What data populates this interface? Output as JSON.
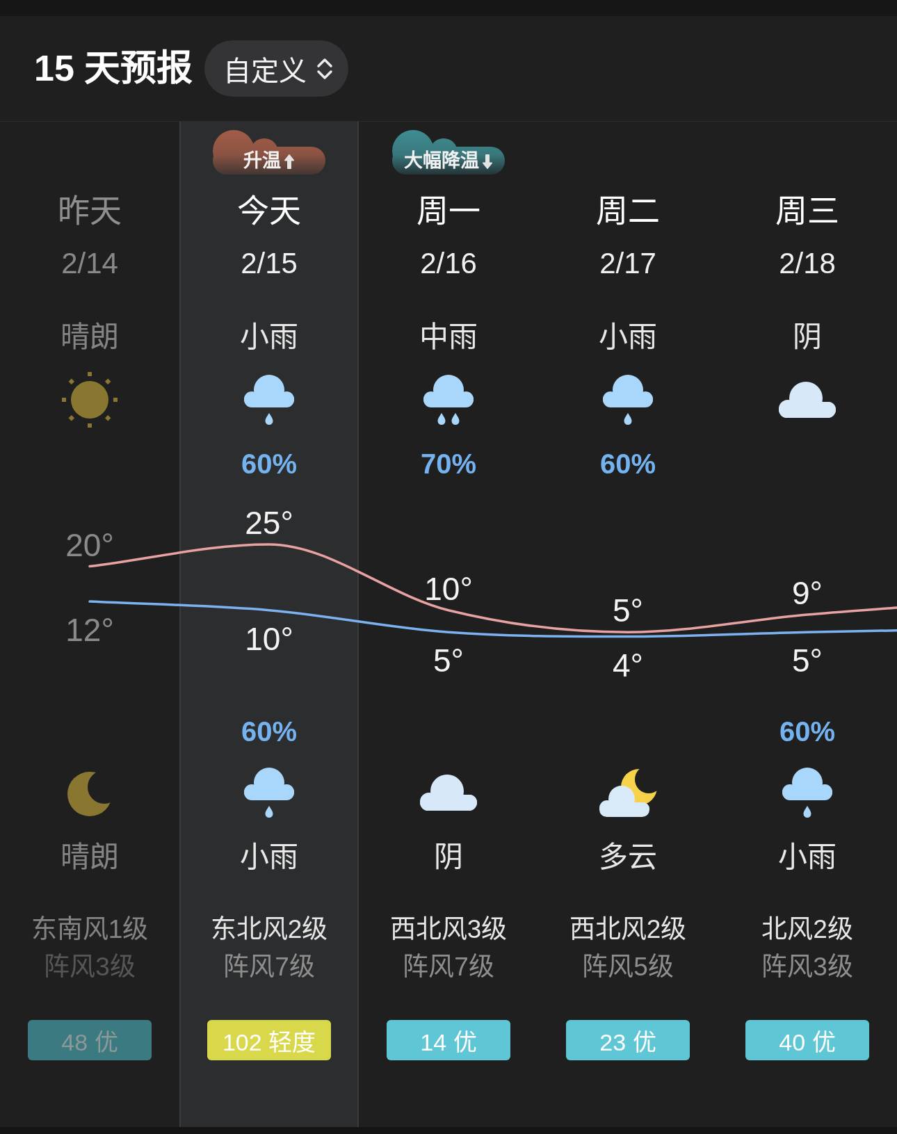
{
  "header": {
    "title": "15 天预报",
    "picker": {
      "label": "自定义"
    }
  },
  "days": [
    {
      "day": "昨天",
      "date": "2/14",
      "past": true,
      "selected": false,
      "day_weather": {
        "kind": "sunny",
        "condition": "晴朗"
      },
      "high": "20°",
      "low": "12°",
      "night_weather": {
        "kind": "moon",
        "condition": "晴朗"
      },
      "wind": "东南风1级",
      "gust": "阵风3级",
      "aqi": {
        "label": "48 优",
        "color": "#3b7a80"
      }
    },
    {
      "day": "今天",
      "date": "2/15",
      "past": false,
      "selected": true,
      "trend": {
        "kind": "rise",
        "label": "升温",
        "color": "#a35d48"
      },
      "day_weather": {
        "kind": "drizzle",
        "condition": "小雨",
        "precip": "60%"
      },
      "high": "25°",
      "low": "10°",
      "night_weather": {
        "kind": "drizzle",
        "condition": "小雨",
        "precip": "60%"
      },
      "wind": "东北风2级",
      "gust": "阵风7级",
      "aqi": {
        "label": "102 轻度",
        "color": "#d9d84b"
      }
    },
    {
      "day": "周一",
      "date": "2/16",
      "past": false,
      "selected": false,
      "trend": {
        "kind": "drop",
        "label": "大幅降温",
        "color": "#3f8e93"
      },
      "day_weather": {
        "kind": "rain",
        "condition": "中雨",
        "precip": "70%"
      },
      "high": "10°",
      "low": "5°",
      "night_weather": {
        "kind": "overcast",
        "condition": "阴"
      },
      "wind": "西北风3级",
      "gust": "阵风7级",
      "aqi": {
        "label": "14 优",
        "color": "#5fc6d5"
      }
    },
    {
      "day": "周二",
      "date": "2/17",
      "past": false,
      "selected": false,
      "day_weather": {
        "kind": "drizzle",
        "condition": "小雨",
        "precip": "60%"
      },
      "high": "5°",
      "low": "4°",
      "night_weather": {
        "kind": "cloudymoon",
        "condition": "多云"
      },
      "wind": "西北风2级",
      "gust": "阵风5级",
      "aqi": {
        "label": "23 优",
        "color": "#5fc6d5"
      }
    },
    {
      "day": "周三",
      "date": "2/18",
      "past": false,
      "selected": false,
      "day_weather": {
        "kind": "overcast",
        "condition": "阴"
      },
      "high": "9°",
      "low": "5°",
      "night_weather": {
        "kind": "drizzle",
        "condition": "小雨",
        "precip": "60%"
      },
      "wind": "北风2级",
      "gust": "阵风3级",
      "aqi": {
        "label": "40 优",
        "color": "#5fc6d5"
      }
    }
  ]
}
